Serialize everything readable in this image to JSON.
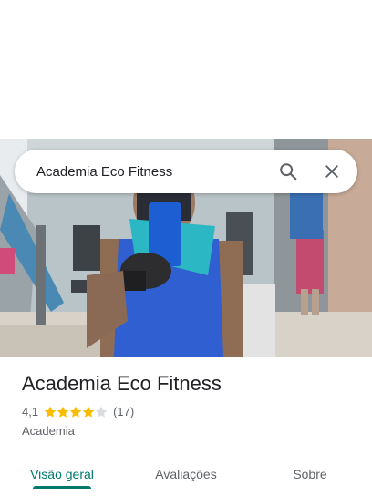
{
  "search": {
    "query": "Academia Eco Fitness"
  },
  "place": {
    "name": "Academia Eco Fitness",
    "rating": "4,1",
    "rating_value": 4.1,
    "rating_max": 5,
    "review_count": "(17)",
    "category": "Academia"
  },
  "tabs": [
    {
      "label": "Visão geral",
      "active": true
    },
    {
      "label": "Avaliações",
      "active": false
    },
    {
      "label": "Sobre",
      "active": false
    }
  ],
  "icons": {
    "search": "search-icon",
    "close": "close-icon",
    "star": "star-icon"
  },
  "colors": {
    "accent": "#00796b",
    "star": "#fbbc04",
    "star_empty": "#dadce0",
    "text": "#202124",
    "muted": "#5f6368"
  }
}
